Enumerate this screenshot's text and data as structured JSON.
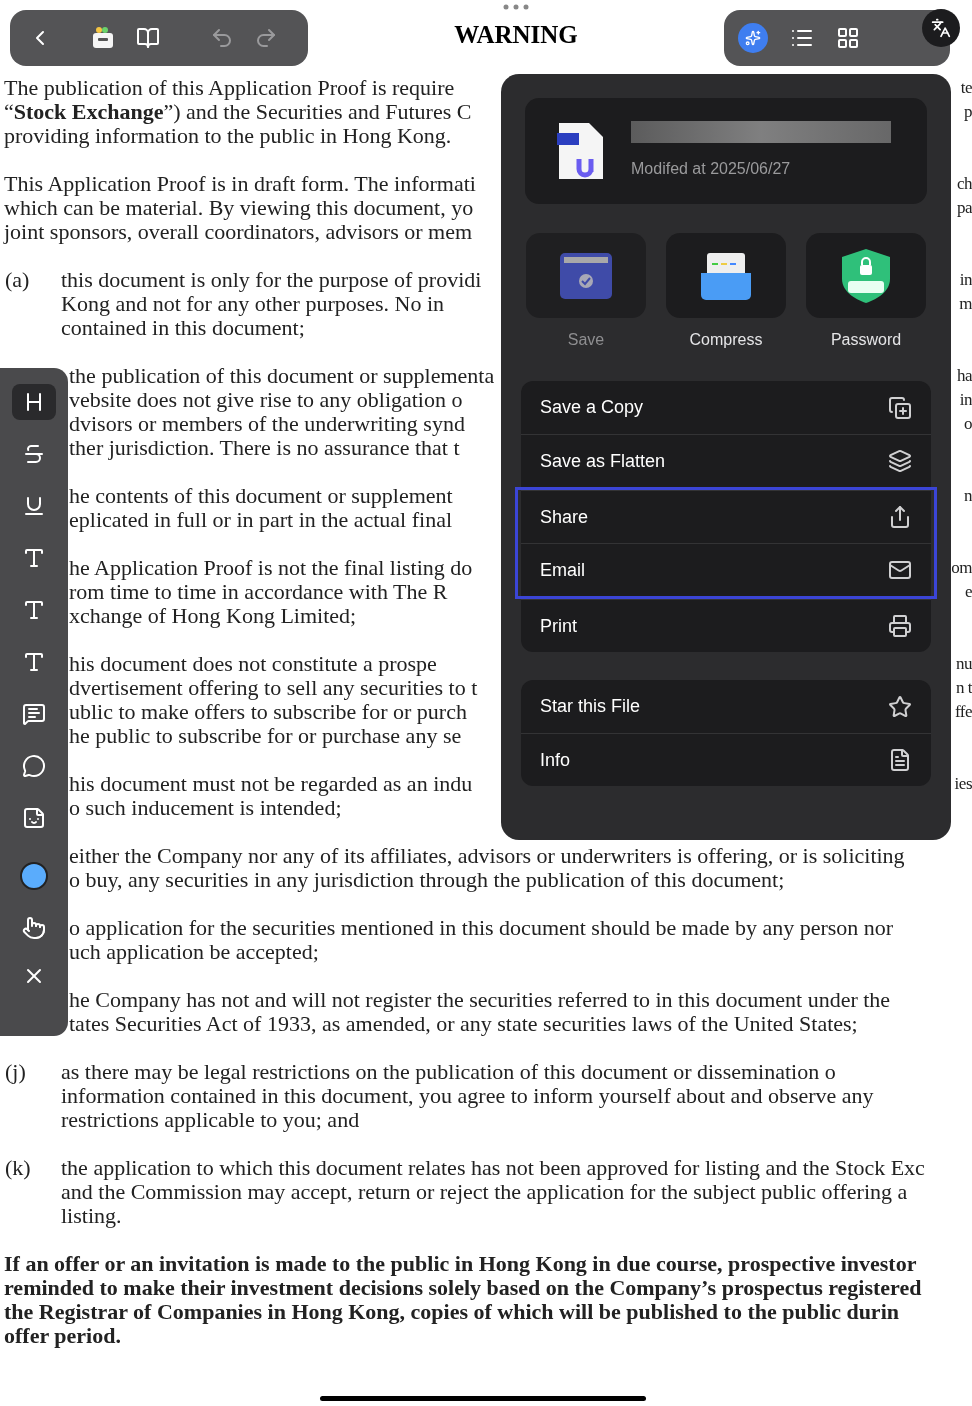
{
  "top_bar": {
    "title": "WARNING"
  },
  "document": {
    "paragraphs": [
      {
        "kind": "plain",
        "lines": [
          {
            "text": "The publication of this Application Proof is require",
            "right": "te"
          },
          {
            "text": "“**Stock Exchange**”) and the Securities and Futures C",
            "right": "p"
          },
          {
            "text": "providing information to the public in Hong Kong."
          }
        ]
      },
      {
        "kind": "plain",
        "lines": [
          {
            "text": "This Application Proof is in draft form. The informati",
            "right": "ch"
          },
          {
            "text": "which can be material. By viewing this document, yo",
            "right": "pa"
          },
          {
            "text": "joint sponsors, overall coordinators, advisors or mem"
          }
        ]
      },
      {
        "kind": "item",
        "label": "(a)",
        "lines": [
          {
            "text": "this document is only for the purpose of providi",
            "right": "in"
          },
          {
            "text": "Kong and not for any other purposes. No in",
            "right": "m"
          },
          {
            "text": "contained in this document;"
          }
        ]
      },
      {
        "kind": "clipped",
        "lines": [
          {
            "text": "the publication of this document or supplementa",
            "right": "ha"
          },
          {
            "text": "vebsite does not give rise to any obligation o",
            "right": "in"
          },
          {
            "text": "dvisors or members of the underwriting synd",
            "right": "o"
          },
          {
            "text": "ther jurisdiction. There is no assurance that t"
          }
        ]
      },
      {
        "kind": "clipped",
        "lines": [
          {
            "text": "he contents of this document or supplement",
            "right": "n"
          },
          {
            "text": "eplicated in full or in part in the actual final"
          }
        ]
      },
      {
        "kind": "clipped",
        "lines": [
          {
            "text": "he Application Proof is not the final listing do",
            "right": "om"
          },
          {
            "text": "rom time to time in accordance with The R",
            "right": "e"
          },
          {
            "text": "xchange of Hong Kong Limited;"
          }
        ]
      },
      {
        "kind": "clipped",
        "lines": [
          {
            "text": "his document does not constitute a prospe",
            "right": "nu"
          },
          {
            "text": "dvertisement offering to sell any securities to t",
            "right": "n t"
          },
          {
            "text": "ublic to make offers to subscribe for or purch",
            "right": "ffe"
          },
          {
            "text": "he public to subscribe for or purchase any se"
          }
        ]
      },
      {
        "kind": "clipped",
        "lines": [
          {
            "text": "his document must not be regarded as an indu",
            "right": "ies"
          },
          {
            "text": "o such inducement is intended;"
          }
        ]
      },
      {
        "kind": "clipped",
        "lines": [
          {
            "text": "either the Company nor any of its affiliates, advisors or underwriters is offering, or is soliciting"
          },
          {
            "text": "o buy, any securities in any jurisdiction through the publication of this document;"
          }
        ]
      },
      {
        "kind": "clipped",
        "lines": [
          {
            "text": "o application for the securities mentioned in this document should be made by any person nor"
          },
          {
            "text": "uch application be accepted;"
          }
        ]
      },
      {
        "kind": "clipped",
        "lines": [
          {
            "text": "he Company has not and will not register the securities referred to in this document under the"
          },
          {
            "text": "tates Securities Act of 1933, as amended, or any state securities laws of the United States;"
          }
        ]
      },
      {
        "kind": "item",
        "label": "(j)",
        "lines": [
          {
            "text": "as there may be legal restrictions on the publication of this document or dissemination o"
          },
          {
            "text": "information contained in this document, you agree to inform yourself about and observe any"
          },
          {
            "text": "restrictions applicable to you; and"
          }
        ]
      },
      {
        "kind": "item",
        "label": "(k)",
        "lines": [
          {
            "text": "the application to which this document relates has not been approved for listing and the Stock Exc"
          },
          {
            "text": "and the Commission may accept, return or reject the application for the subject public offering a"
          },
          {
            "text": "listing."
          }
        ]
      },
      {
        "kind": "bold",
        "lines": [
          {
            "text": "If an offer or an invitation is made to the public in Hong Kong in due course, prospective investor"
          },
          {
            "text": "reminded to make their investment decisions solely based on the Company’s prospectus registered"
          },
          {
            "text": "the Registrar of Companies in Hong Kong, copies of which will be published to the public durin"
          },
          {
            "text": "offer period."
          }
        ]
      }
    ]
  },
  "annotation_toolbar": {
    "tools": [
      {
        "selected": true
      },
      {
        "selected": false
      },
      {
        "selected": false
      },
      {
        "selected": false
      },
      {
        "selected": false
      },
      {
        "selected": false
      },
      {
        "selected": false
      },
      {
        "selected": false
      },
      {
        "selected": false
      }
    ],
    "color": "#5aacfc"
  },
  "file_menu": {
    "file": {
      "modified": "Modifed at 2025/06/27"
    },
    "actions": [
      {
        "label": "Save",
        "disabled": true
      },
      {
        "label": "Compress",
        "disabled": false
      },
      {
        "label": "Password",
        "disabled": false
      }
    ],
    "groups": [
      {
        "items": [
          {
            "label": "Save a Copy",
            "highlighted": false
          },
          {
            "label": "Save as Flatten",
            "highlighted": false
          },
          {
            "label": "Share",
            "highlighted": true
          },
          {
            "label": "Email",
            "highlighted": true
          },
          {
            "label": "Print",
            "highlighted": false
          }
        ]
      },
      {
        "items": [
          {
            "label": "Star this File",
            "highlighted": false
          },
          {
            "label": "Info",
            "highlighted": false
          }
        ]
      }
    ]
  }
}
